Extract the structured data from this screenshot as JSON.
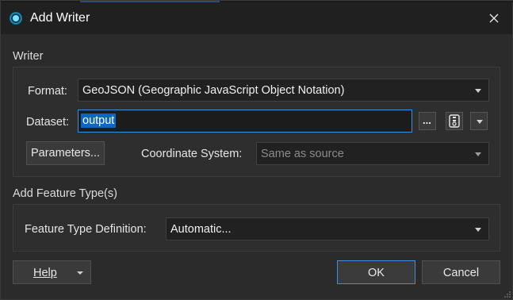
{
  "window": {
    "title": "Add Writer"
  },
  "writer": {
    "section_label": "Writer",
    "format_label": "Format:",
    "format_value": "GeoJSON (Geographic JavaScript Object Notation)",
    "dataset_label": "Dataset:",
    "dataset_value": "output",
    "browse_label": "...",
    "parameters_label": "Parameters...",
    "coord_label": "Coordinate System:",
    "coord_value": "Same as source"
  },
  "feature_types": {
    "section_label": "Add Feature Type(s)",
    "definition_label": "Feature Type Definition:",
    "definition_value": "Automatic..."
  },
  "footer": {
    "help_label": "Help",
    "ok_label": "OK",
    "cancel_label": "Cancel"
  },
  "icons": {
    "app": "fme-app-icon",
    "close": "close-icon",
    "archive": "zip-archive-icon",
    "dropdown": "chevron-down-icon"
  },
  "colors": {
    "accent": "#3e8fd6",
    "selection": "#0b67c6",
    "background": "#2b2b2b"
  }
}
